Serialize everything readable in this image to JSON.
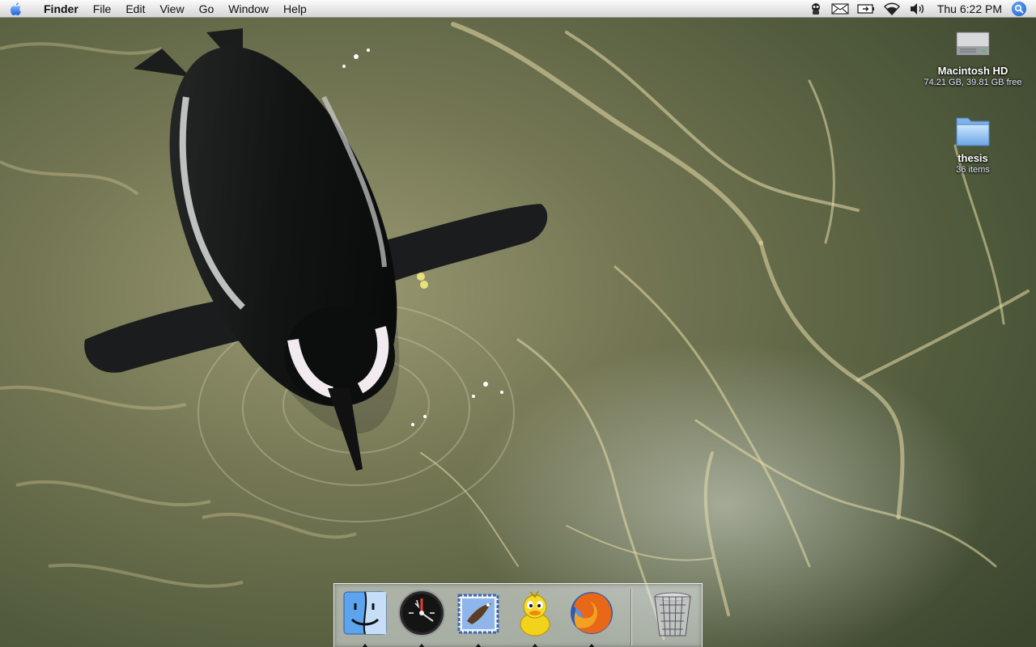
{
  "menubar": {
    "apple_icon": "apple-icon",
    "app_name": "Finder",
    "menus": [
      "File",
      "Edit",
      "View",
      "Go",
      "Window",
      "Help"
    ],
    "status_icons": [
      "robot-icon",
      "mail-icon",
      "battery-icon",
      "wifi-icon",
      "volume-icon"
    ],
    "clock": "Thu 6:22 PM",
    "spotlight_icon": "spotlight-search-icon"
  },
  "desktop": {
    "icons": [
      {
        "name": "Macintosh HD",
        "info": "74.21 GB, 39.81 GB free",
        "icon": "hard-drive-icon"
      },
      {
        "name": "thesis",
        "info": "36 items",
        "icon": "folder-icon"
      }
    ]
  },
  "dock": {
    "apps": [
      {
        "icon": "finder-icon",
        "running": true
      },
      {
        "icon": "dashboard-icon",
        "running": true
      },
      {
        "icon": "mail-app-icon",
        "running": true
      },
      {
        "icon": "adium-duck-icon",
        "running": true
      },
      {
        "icon": "firefox-icon",
        "running": true
      }
    ],
    "trash_icon": "trash-icon"
  },
  "colors": {
    "water_dark": "#3e4a30",
    "water_light": "#b9b58a",
    "caustic": "#e6dcac",
    "menubar": "#e8e8e8",
    "selection_blue": "#1a5fd0"
  }
}
